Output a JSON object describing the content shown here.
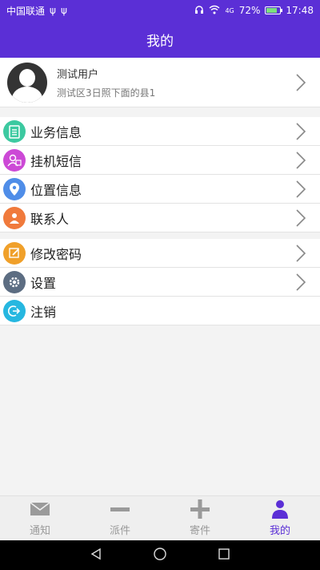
{
  "status_bar": {
    "carrier": "中国联通",
    "usb1": "ψ",
    "usb2": "ψ",
    "signal_label": "4G",
    "battery_percent": "72%",
    "time": "17:48"
  },
  "header": {
    "title": "我的"
  },
  "profile": {
    "name": "测试用户",
    "address": "测试区3日照下面的县1"
  },
  "menu_groups": [
    [
      {
        "label": "业务信息",
        "icon": "clipboard-icon",
        "color": "#3cc9a0"
      },
      {
        "label": "挂机短信",
        "icon": "sms-icon",
        "color": "#cc49d6"
      },
      {
        "label": "位置信息",
        "icon": "location-icon",
        "color": "#4f8de8"
      },
      {
        "label": "联系人",
        "icon": "contact-icon",
        "color": "#f07a3c"
      }
    ],
    [
      {
        "label": "修改密码",
        "icon": "edit-icon",
        "color": "#f0a02a"
      },
      {
        "label": "设置",
        "icon": "gear-icon",
        "color": "#5c6d82"
      },
      {
        "label": "注销",
        "icon": "logout-icon",
        "color": "#26b7e0"
      }
    ]
  ],
  "tabs": [
    {
      "label": "通知",
      "icon": "mail-icon",
      "active": false
    },
    {
      "label": "派件",
      "icon": "minus-icon",
      "active": false
    },
    {
      "label": "寄件",
      "icon": "plus-icon",
      "active": false
    },
    {
      "label": "我的",
      "icon": "person-icon",
      "active": true
    }
  ],
  "colors": {
    "primary": "#5b2fd6",
    "inactive": "#9a9a9a"
  }
}
